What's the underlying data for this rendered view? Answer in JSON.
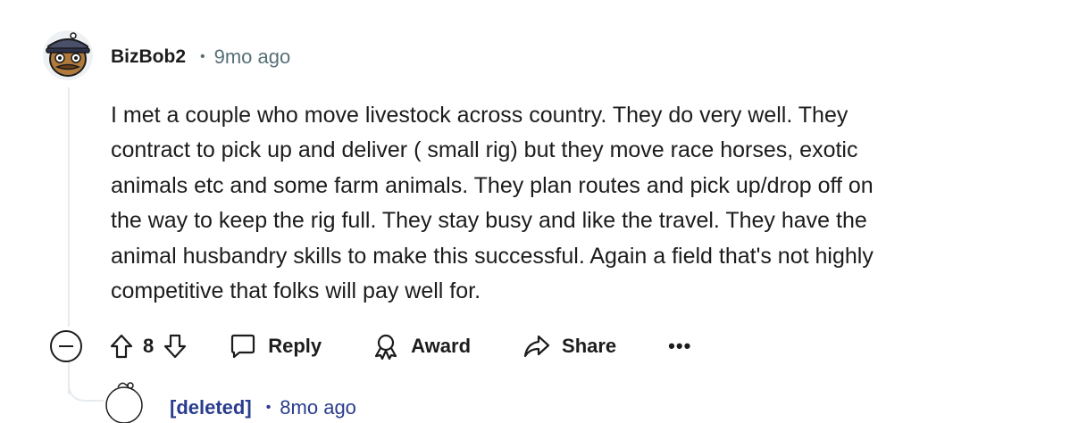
{
  "comment": {
    "author": "BizBob2",
    "separator": "•",
    "time": "9mo ago",
    "body": "I met a couple who move livestock across country. They do very well. They contract to pick up and deliver ( small rig) but they move race horses, exotic animals etc and some farm animals. They plan routes and pick up/drop off on the way to keep the rig full. They stay busy and like the travel. They have the animal husbandry skills to make this successful. Again a field that's not highly competitive that folks will pay well for.",
    "body_lines": [
      "I met a couple who move livestock across country. They do very well. They",
      "contract to pick up and deliver ( small rig) but they move race horses, exotic",
      "animals etc and some farm animals. They plan routes and pick up/drop off on",
      "the way to keep the rig full. They stay busy and like the travel. They have the",
      "animal husbandry skills to make this successful. Again a field that's not highly",
      "competitive that folks will pay well for."
    ],
    "score": "8"
  },
  "actions": {
    "reply_label": "Reply",
    "award_label": "Award",
    "share_label": "Share",
    "more_label": "•••"
  },
  "child": {
    "author": "[deleted]",
    "separator": "•",
    "time": "8mo ago"
  },
  "colors": {
    "meta": "#576f76",
    "thread_line": "#e5ebee",
    "deleted_link": "#2a3c8e"
  }
}
